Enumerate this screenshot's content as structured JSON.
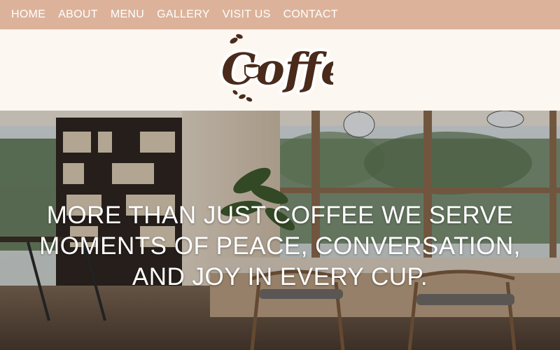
{
  "nav": {
    "items": [
      {
        "label": "HOME"
      },
      {
        "label": "ABOUT"
      },
      {
        "label": "MENU"
      },
      {
        "label": "GALLERY"
      },
      {
        "label": "VISIT US"
      },
      {
        "label": "CONTACT"
      }
    ]
  },
  "logo": {
    "text": "Coffee"
  },
  "hero": {
    "headline": "MORE THAN JUST COFFEE WE SERVE MOMENTS OF PEACE, CONVERSATION, AND JOY IN EVERY CUP."
  },
  "colors": {
    "nav_background": "#dcb39a",
    "page_background": "#fdf7f1",
    "logo_brown": "#4a2a1a",
    "headline_text": "#ffffff"
  }
}
